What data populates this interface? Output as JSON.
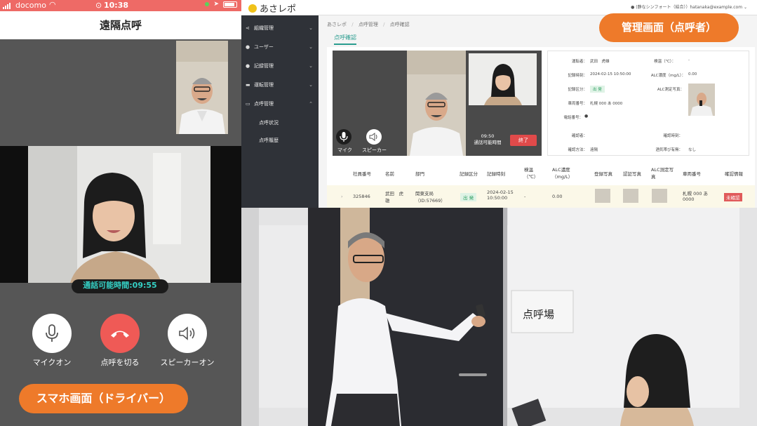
{
  "status_bar": {
    "carrier": "docomo",
    "time": "10:38"
  },
  "phone": {
    "title": "遠隔点呼",
    "call_time": "通話可能時間:09:55",
    "controls": {
      "mic_label": "マイクオン",
      "hangup_label": "点呼を切る",
      "speaker_label": "スピーカーオン"
    },
    "caption": "スマホ画面（ドライバー）"
  },
  "admin": {
    "logo": "あさレポ",
    "user": "(静なシンフォート（結合））hatanaka@example.com",
    "caption": "管理画面（点呼者）",
    "sidebar": {
      "items": [
        {
          "label": "組織管理"
        },
        {
          "label": "ユーザー"
        },
        {
          "label": "記録管理"
        },
        {
          "label": "運転管理"
        },
        {
          "label": "点呼管理"
        }
      ],
      "sub_items": [
        "点呼状況",
        "点呼履歴"
      ]
    },
    "breadcrumb": [
      "あさレポ",
      "点呼管理",
      "点呼確認"
    ],
    "page_tab": "点呼確認",
    "video": {
      "mic_label": "マイク",
      "speaker_label": "スピーカー",
      "time": "09:50",
      "time_label": "通話可能時間",
      "end_label": "終了"
    },
    "info": {
      "driver_key": "運転者：",
      "driver_val": "武田　虎雄",
      "temp_key": "検温（℃）：",
      "temp_val": "-",
      "record_time_key": "記録時刻：",
      "record_time_val": "2024-02-15 10:50:00",
      "alc_key": "ALC濃度（mg/L）：",
      "alc_val": "0.00",
      "type_key": "記録区分：",
      "type_val": "出 発",
      "alc_photo_key": "ALC測定写真：",
      "vehicle_key": "車両番号：",
      "vehicle_val": "札幌 000 あ 0000",
      "phone_key": "電話番号：",
      "confirmer_key": "確認者：",
      "confirm_time_key": "確認時刻：",
      "method_key": "確認方法：",
      "method_val": "遠隔",
      "drinking_key": "酒気帯び有無：",
      "drinking_val": "なし"
    },
    "table": {
      "headers": [
        "社員番号",
        "名前",
        "部門",
        "記録区分",
        "記録時刻",
        "検温（℃）",
        "ALC濃度（mg/L）",
        "登録写真",
        "認証写真",
        "ALC測定写真",
        "車両番号",
        "確認情報"
      ],
      "row": {
        "id": "325846",
        "name": "武田　虎雄",
        "dept": "関東支局（ID:57669）",
        "type": "出 発",
        "time": "2024-02-15 10:50:00",
        "temp": "-",
        "alc": "0.00",
        "vehicle": "札幌 000 あ 0000",
        "status": "未確認"
      }
    }
  },
  "camera": {
    "sign": "点呼場"
  },
  "colors": {
    "accent_orange": "#ee7a2a",
    "hangup_red": "#ef5a56",
    "status_bar": "#ee6a66",
    "teal": "#34d1c6",
    "sidebar": "#2f3238"
  }
}
